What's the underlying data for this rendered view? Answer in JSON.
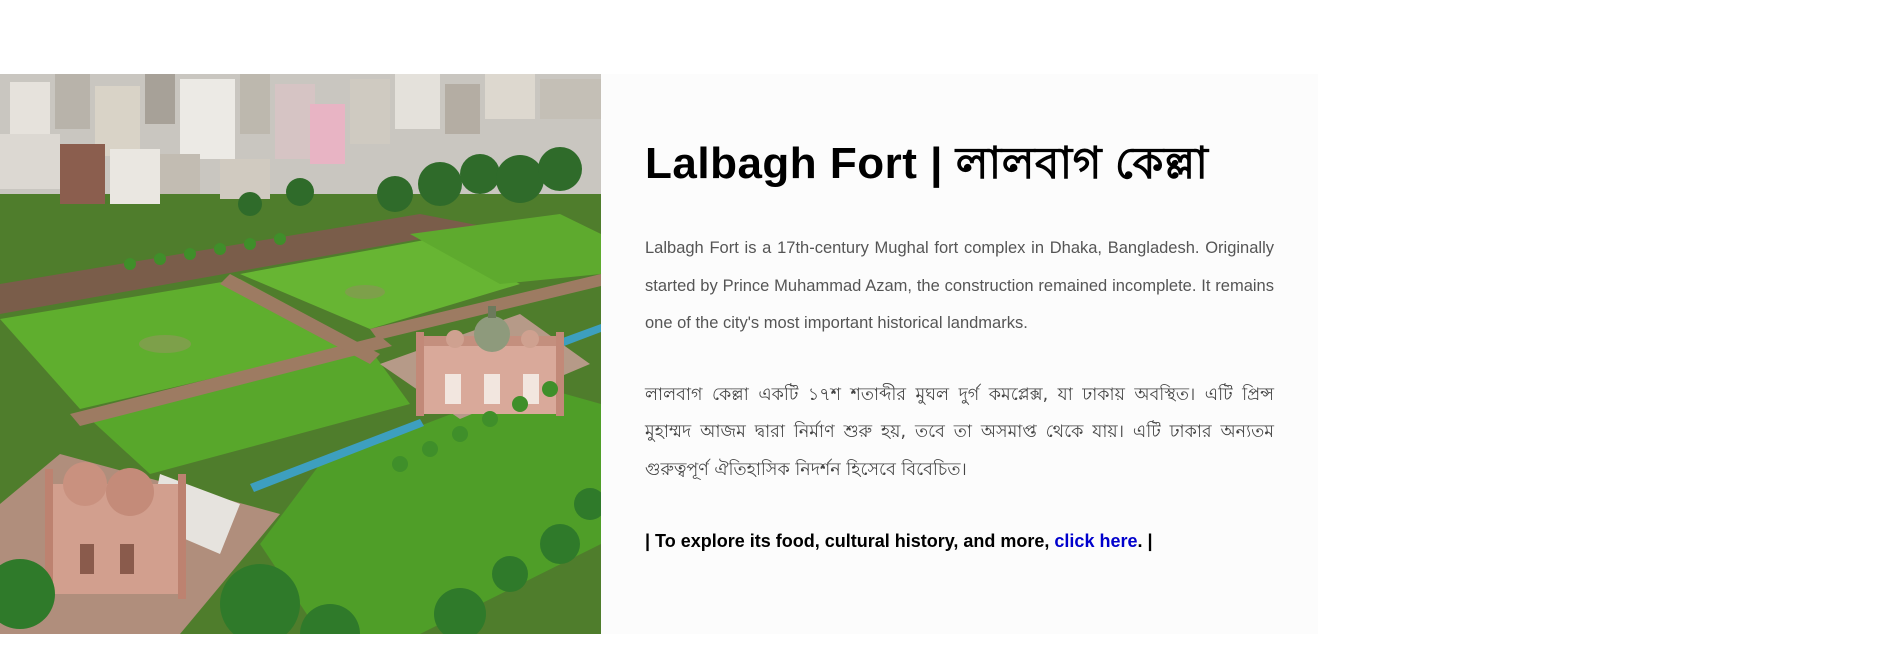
{
  "card": {
    "image_alt": "Aerial view of Lalbagh Fort",
    "title": "Lalbagh Fort | লালবাগ কেল্লা",
    "description_en": "Lalbagh Fort is a 17th-century Mughal fort complex in Dhaka, Bangladesh. Originally started by Prince Muhammad Azam, the construction remained incomplete. It remains one of the city's most important historical landmarks.",
    "description_bn": "লালবাগ কেল্লা একটি ১৭শ শতাব্দীর মুঘল দুর্গ কমপ্লেক্স, যা ঢাকায় অবস্থিত। এটি প্রিন্স মুহাম্মদ আজম দ্বারা নির্মাণ শুরু হয়, তবে তা অসমাপ্ত থেকে যায়। এটি ঢাকার অন্যতম গুরুত্বপূর্ণ ঐতিহাসিক নিদর্শন হিসেবে বিবেচিত।",
    "cta_prefix": "| To explore its food, cultural history, and more, ",
    "cta_link": "click here",
    "cta_suffix": ". |"
  },
  "colors": {
    "link": "#0000cc",
    "panel_bg": "#fcfcfc"
  }
}
